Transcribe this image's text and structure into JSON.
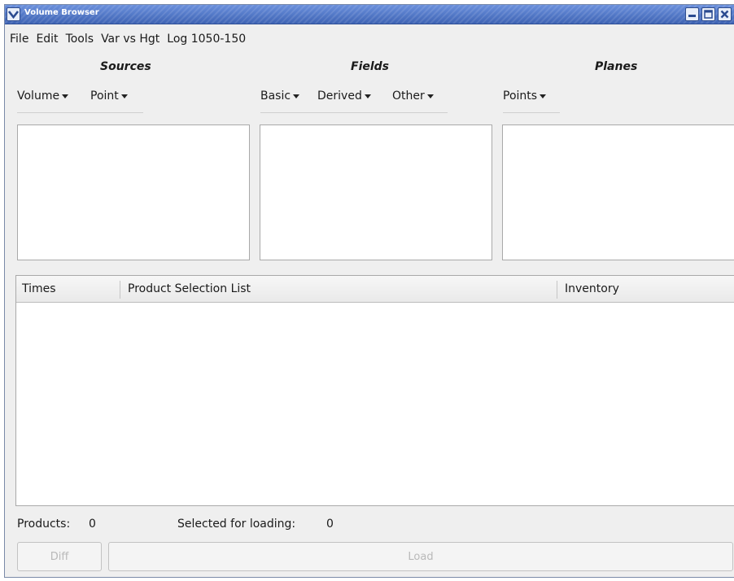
{
  "window": {
    "title": "Volume Browser",
    "accent": "#4a70c2"
  },
  "menubar": {
    "items": [
      "File",
      "Edit",
      "Tools",
      "Var vs Hgt",
      "Log 1050-150"
    ]
  },
  "sections": {
    "sources": "Sources",
    "fields": "Fields",
    "planes": "Planes"
  },
  "dropdowns": {
    "volume": "Volume",
    "point": "Point",
    "basic": "Basic",
    "derived": "Derived",
    "other": "Other",
    "points": "Points"
  },
  "table": {
    "columns": [
      "Times",
      "Product Selection List",
      "Inventory"
    ]
  },
  "status": {
    "products_label": "Products:",
    "products_value": "0",
    "selected_label": "Selected for loading:",
    "selected_value": "0"
  },
  "buttons": {
    "diff": "Diff",
    "load": "Load"
  },
  "icons": {
    "window_menu": "chevron-down-icon",
    "minimize": "minimize-icon",
    "maximize": "maximize-icon",
    "close": "close-icon",
    "dropdown_caret": "caret-down-icon"
  }
}
